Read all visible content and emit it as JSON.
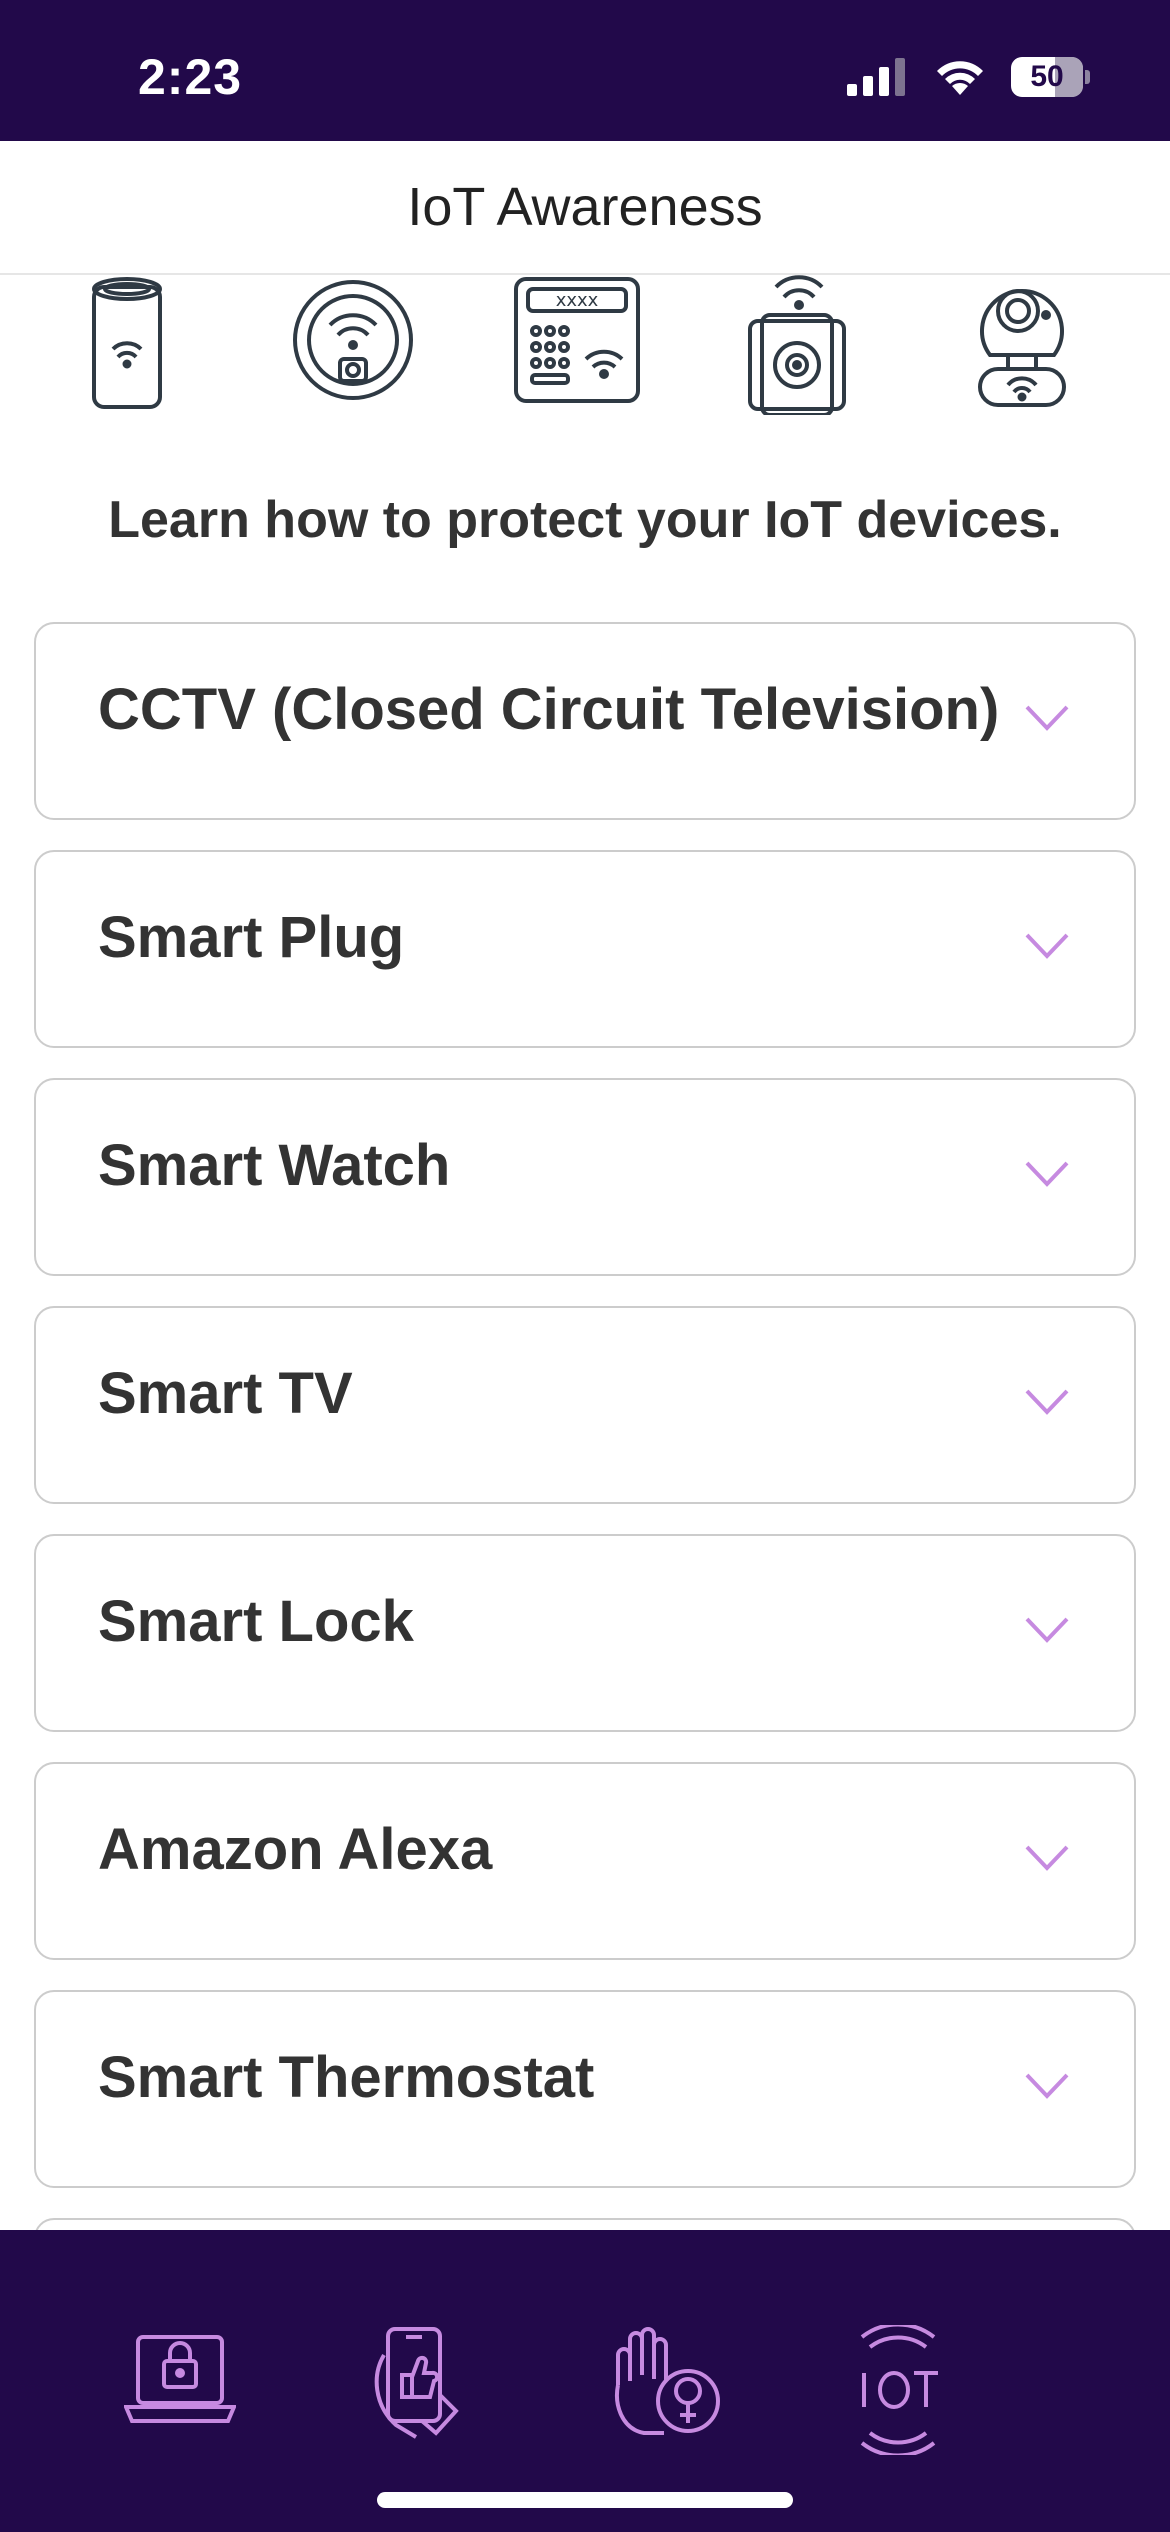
{
  "status_bar": {
    "time": "2:23",
    "battery_level": "50",
    "icons": [
      "cellular-signal-icon",
      "wifi-icon",
      "battery-icon"
    ]
  },
  "header": {
    "title": "IoT Awareness"
  },
  "device_icons": [
    "smart-speaker-icon",
    "robot-vacuum-icon",
    "alarm-keypad-icon",
    "smart-plug-icon",
    "security-camera-icon"
  ],
  "intro": "Learn how to protect your IoT devices.",
  "accordion": {
    "items": [
      {
        "label": "CCTV (Closed Circuit Television)"
      },
      {
        "label": "Smart Plug"
      },
      {
        "label": "Smart Watch"
      },
      {
        "label": "Smart TV"
      },
      {
        "label": "Smart Lock"
      },
      {
        "label": "Amazon Alexa"
      },
      {
        "label": "Smart Thermostat"
      }
    ]
  },
  "bottom_nav": {
    "items": [
      "laptop-lock-icon",
      "phone-thumbs-up-icon",
      "hand-female-icon",
      "iot-icon"
    ]
  },
  "colors": {
    "brand_dark": "#22094a",
    "accent": "#c68ae0",
    "icon_outline": "#2f3a44"
  }
}
